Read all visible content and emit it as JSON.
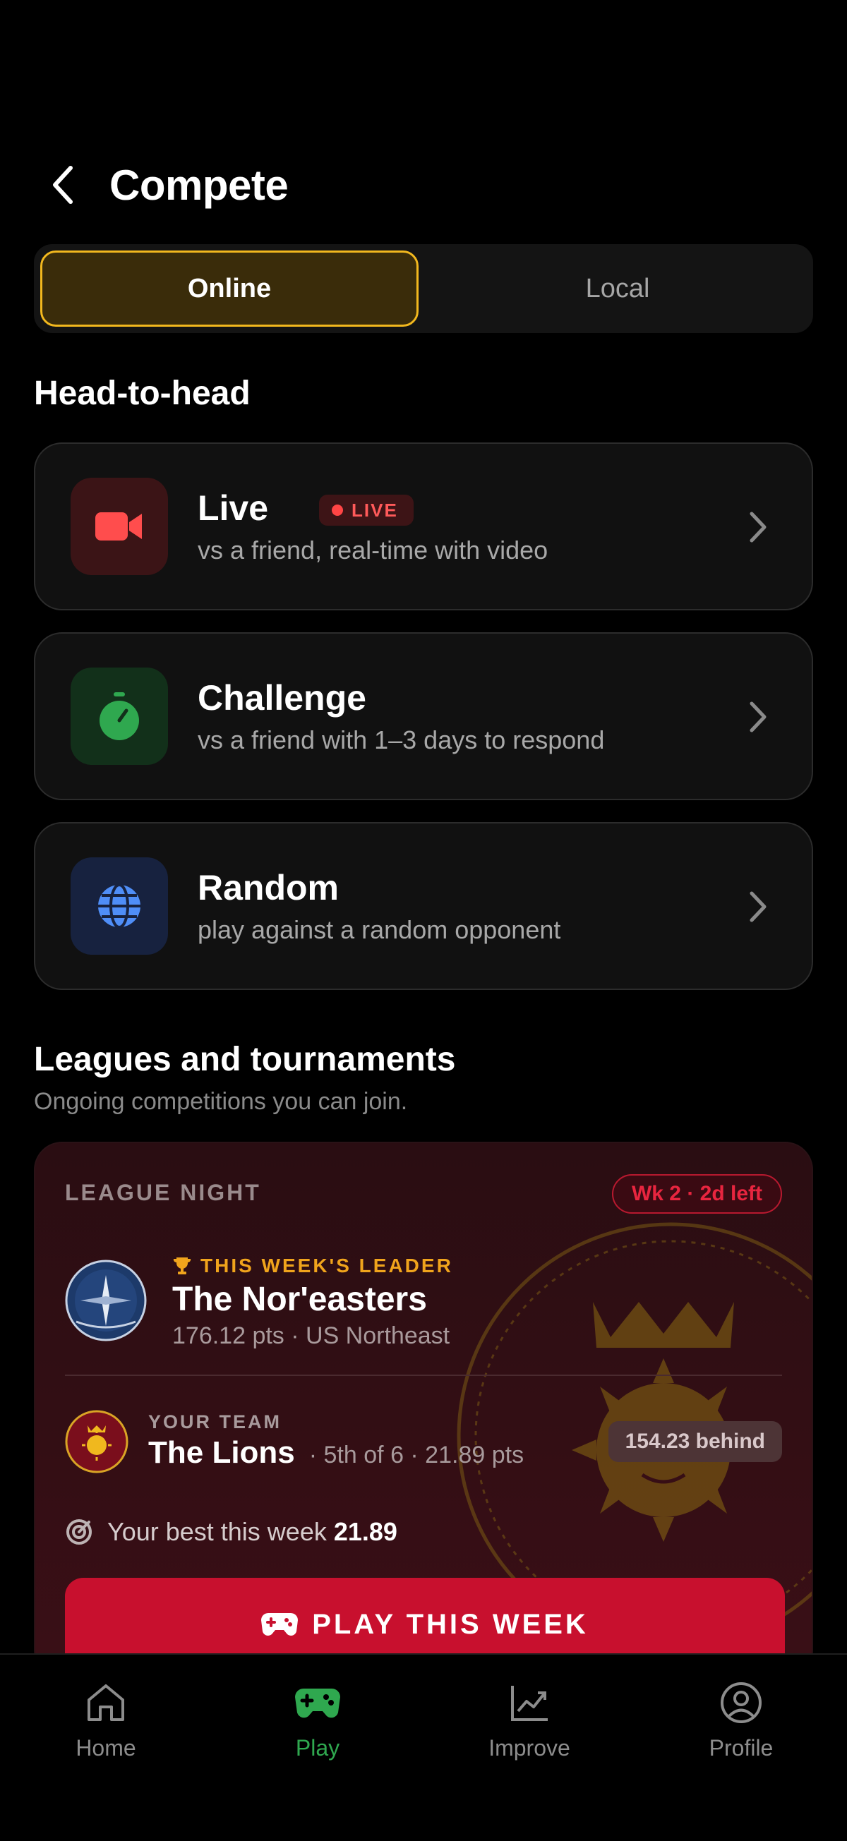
{
  "header": {
    "title": "Compete"
  },
  "mode_toggle": {
    "options": [
      "Online",
      "Local"
    ],
    "selected": "Online"
  },
  "head_to_head": {
    "title": "Head-to-head",
    "cards": [
      {
        "title": "Live",
        "badge": "LIVE",
        "subtitle": "vs a friend, real-time with video",
        "icon": "video-camera-icon",
        "color": "#ff4d4d"
      },
      {
        "title": "Challenge",
        "subtitle": "vs a friend with 1–3 days to respond",
        "icon": "stopwatch-icon",
        "color": "#2fa84f"
      },
      {
        "title": "Random",
        "subtitle": "play against a random opponent",
        "icon": "globe-icon",
        "color": "#4f8ef7"
      }
    ]
  },
  "leagues": {
    "title": "Leagues and tournaments",
    "subtitle": "Ongoing competitions you can join.",
    "card": {
      "label": "LEAGUE NIGHT",
      "week_badge": "Wk 2 · 2d left",
      "leader": {
        "tag": "THIS WEEK'S LEADER",
        "name": "The Nor'easters",
        "meta": "176.12 pts · US Northeast"
      },
      "team": {
        "tag": "YOUR TEAM",
        "name": "The Lions",
        "meta": "· 5th of 6 · 21.89 pts",
        "behind": "154.23 behind"
      },
      "best": {
        "label": "Your best this week",
        "value": "21.89"
      },
      "play_label": "PLAY THIS WEEK"
    }
  },
  "tabbar": {
    "items": [
      {
        "label": "Home",
        "icon": "home-icon"
      },
      {
        "label": "Play",
        "icon": "gamepad-icon",
        "active": true
      },
      {
        "label": "Improve",
        "icon": "trend-chart-icon"
      },
      {
        "label": "Profile",
        "icon": "user-circle-icon"
      }
    ]
  }
}
